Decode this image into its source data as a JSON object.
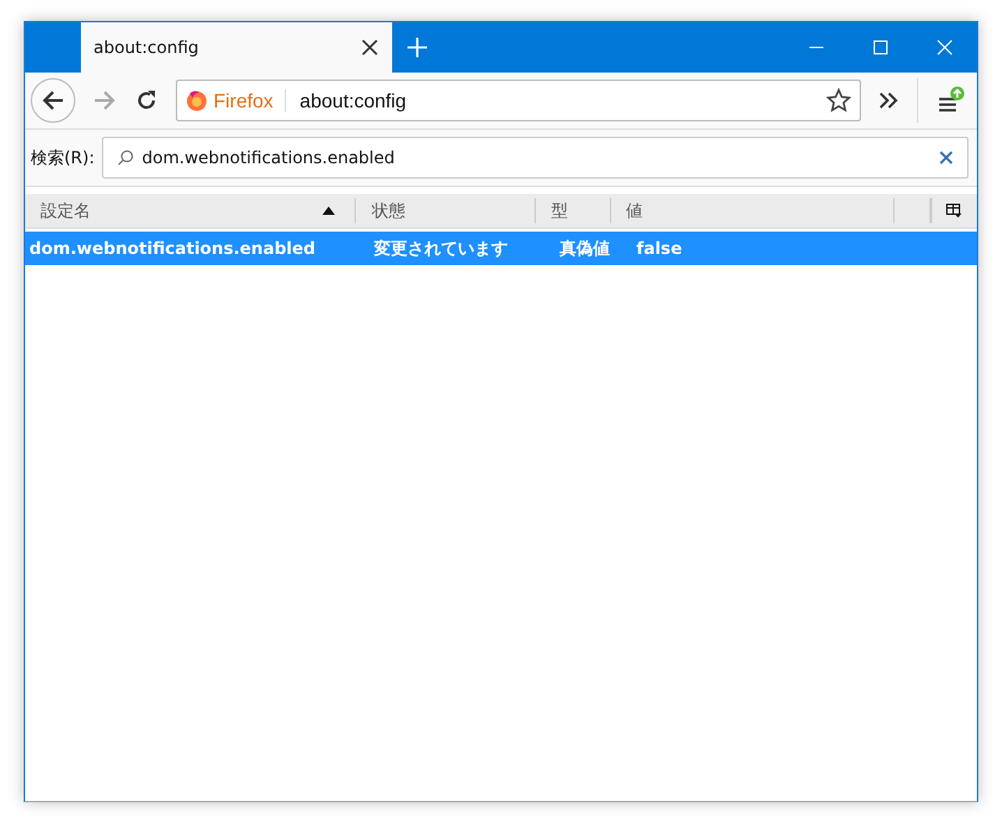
{
  "tabs": [
    {
      "title": "about:config",
      "selected": true
    }
  ],
  "address": {
    "identity": "Firefox",
    "url": "about:config"
  },
  "search": {
    "label": "検索(R):",
    "value": "dom.webnotifications.enabled"
  },
  "table": {
    "columns": [
      {
        "label": "設定名",
        "sorted": true
      },
      {
        "label": "状態",
        "sorted": false
      },
      {
        "label": "型",
        "sorted": false
      },
      {
        "label": "値",
        "sorted": false
      }
    ],
    "rows": [
      {
        "cells": [
          "dom.webnotifications.enabled",
          "変更されています",
          "真偽値",
          "false"
        ],
        "selected": true,
        "modified": true
      }
    ]
  }
}
